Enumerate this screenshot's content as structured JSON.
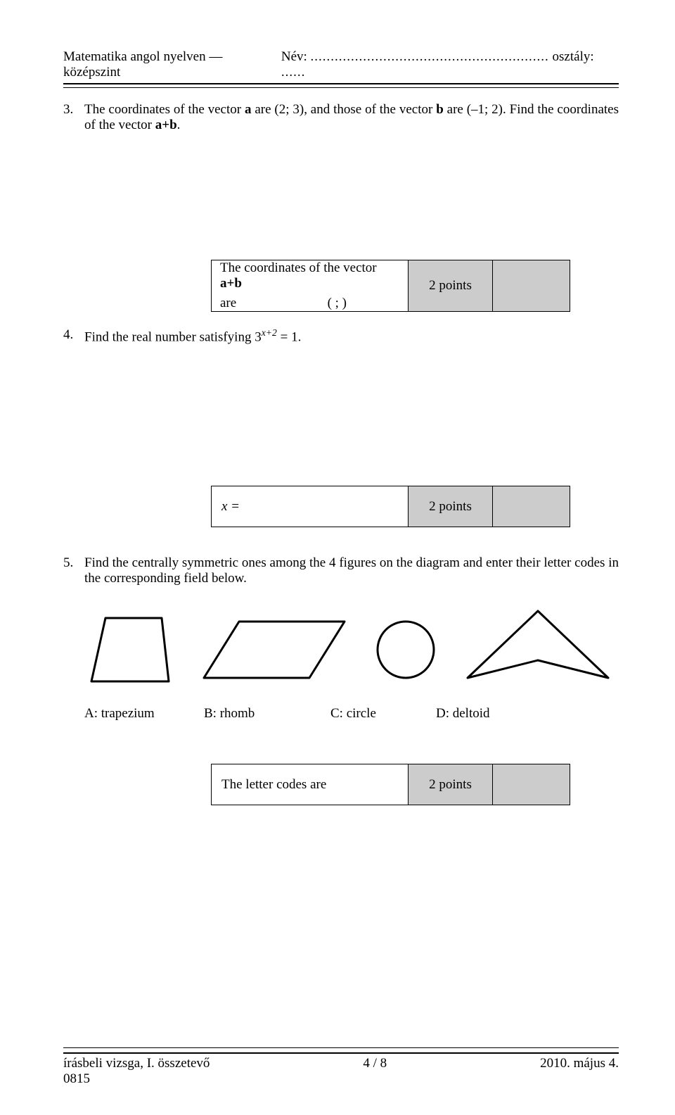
{
  "header": {
    "subject": "Matematika angol nyelven — középszint",
    "name_label": "Név:",
    "name_dots": "...........................................................",
    "class_label": "osztály:",
    "class_dots": "......"
  },
  "q3": {
    "num": "3.",
    "text_1": "The coordinates of the vector ",
    "a": "a",
    "text_2": " are (2; 3), and those of the vector ",
    "b": "b",
    "text_3": " are (–1; 2). Find the coordinates of the vector ",
    "ab": "a+b",
    "period": ".",
    "answer_desc_1": "The coordinates of the vector ",
    "answer_ab": "a+b",
    "answer_are": "are",
    "answer_paren": "(      ;      )",
    "points": "2 points"
  },
  "q4": {
    "num": "4.",
    "text_1": "Find the real number satisfying ",
    "expr_base": "3",
    "expr_sup": "x+2",
    "expr_eq": " = 1",
    "period": ".",
    "answer_x": "x =",
    "points": "2 points"
  },
  "q5": {
    "num": "5.",
    "text": "Find the centrally symmetric ones among the 4 figures on the diagram and enter their letter codes in the corresponding field below.",
    "labels": {
      "a": "A: trapezium",
      "b": "B: rhomb",
      "c": "C: circle",
      "d": "D: deltoid"
    },
    "answer_desc": "The letter codes are",
    "points": "2 points"
  },
  "footer": {
    "left_line1": "írásbeli vizsga, I. összetevő",
    "left_line2": "0815",
    "center": "4 / 8",
    "right": "2010. május 4."
  }
}
